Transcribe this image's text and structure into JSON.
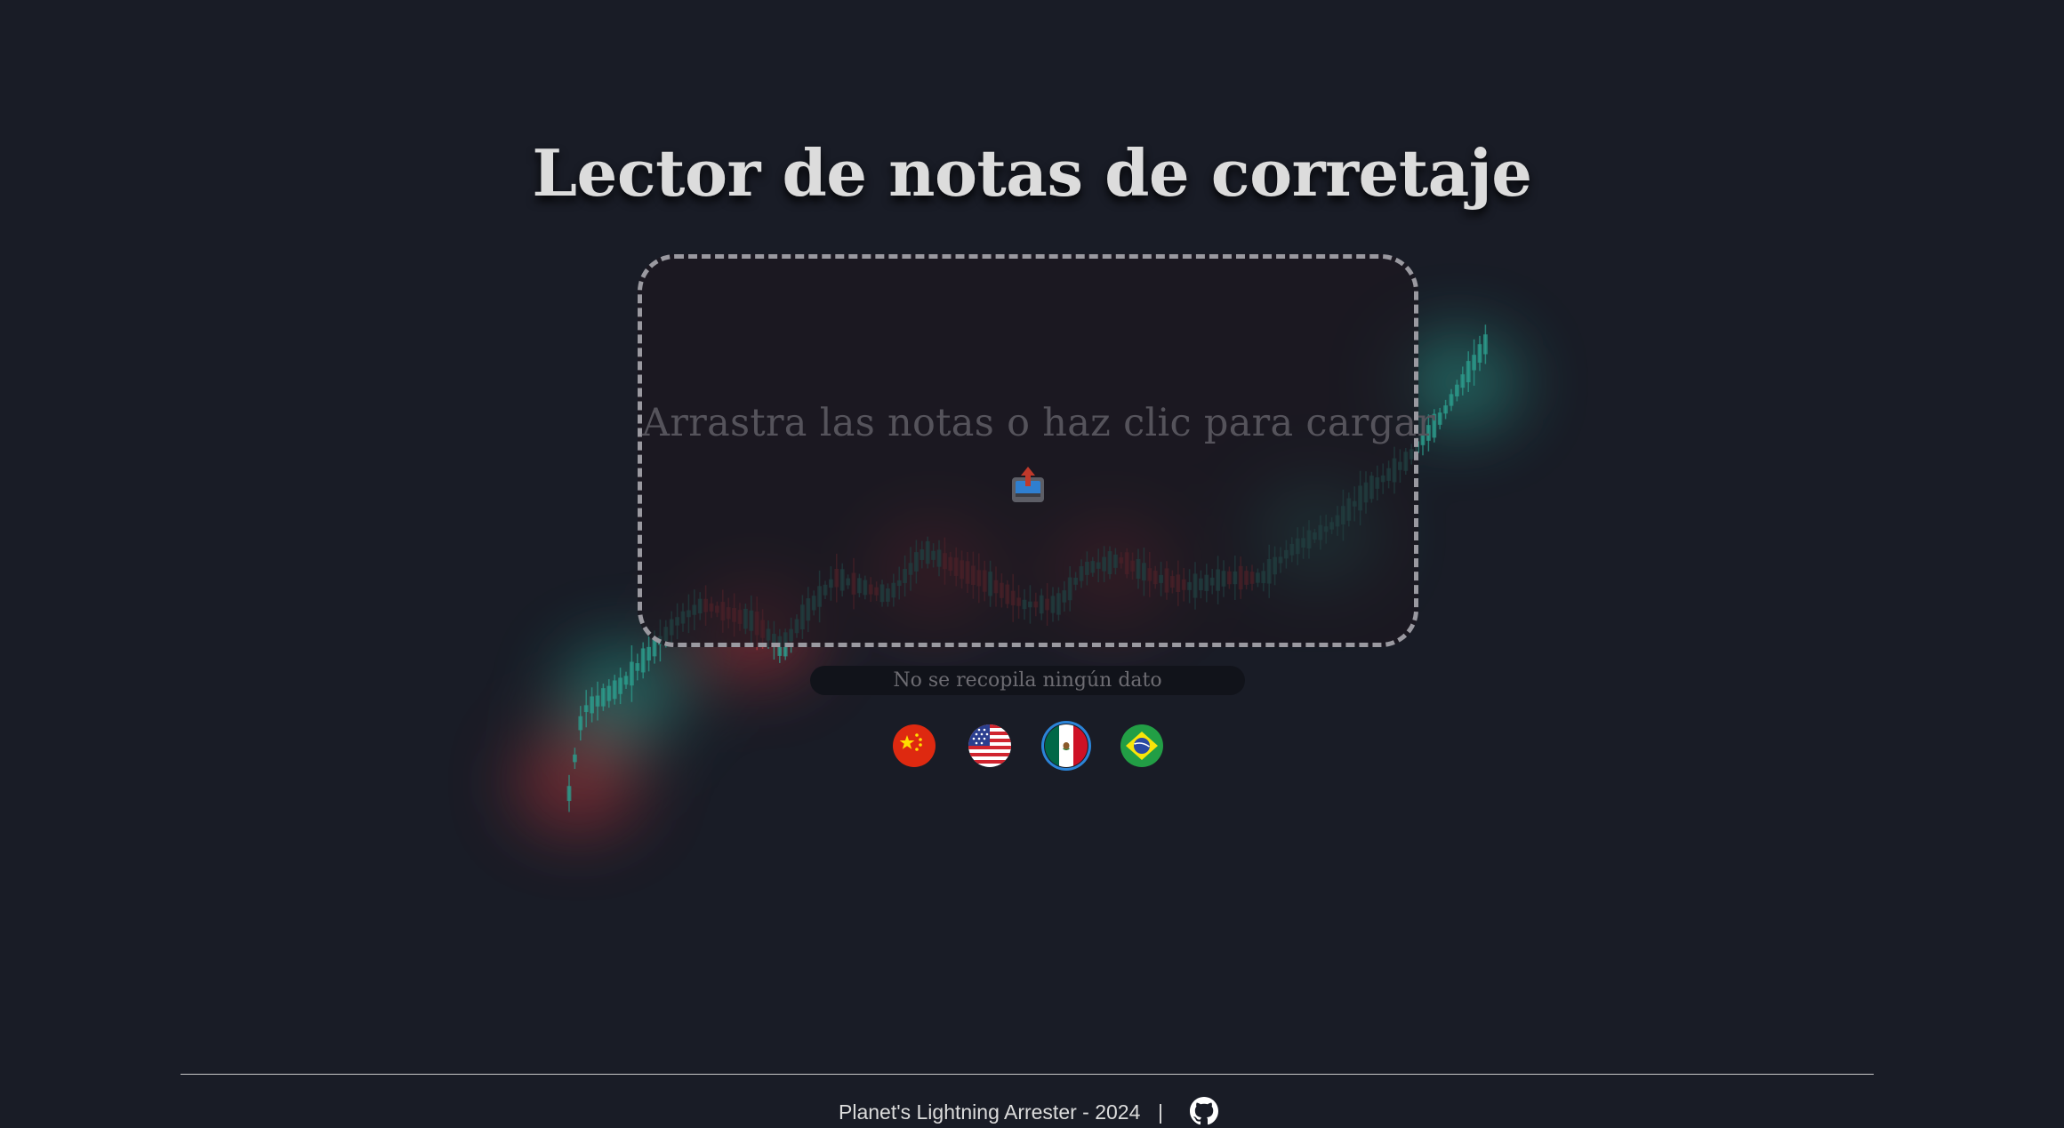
{
  "page": {
    "title": "Lector de notas de corretaje"
  },
  "dropzone": {
    "label": "Arrastra las notas o haz clic para cargar",
    "icon": "upload-tray-icon"
  },
  "privacy": {
    "text": "No se recopila ningún dato"
  },
  "languages": [
    {
      "code": "zh",
      "icon": "china-flag-icon",
      "selected": false
    },
    {
      "code": "en",
      "icon": "usa-flag-icon",
      "selected": false
    },
    {
      "code": "es",
      "icon": "mexico-flag-icon",
      "selected": true
    },
    {
      "code": "pt",
      "icon": "brazil-flag-icon",
      "selected": false
    }
  ],
  "footer": {
    "text": "Planet's Lightning Arrester - 2024",
    "separator": "|",
    "icon": "github-icon"
  },
  "colors": {
    "background": "#191c26",
    "candle_up": "#2c9c8c",
    "candle_down": "#b8363a",
    "selected_ring": "#2b84d8",
    "dropzone_border": "#9a99a0"
  }
}
